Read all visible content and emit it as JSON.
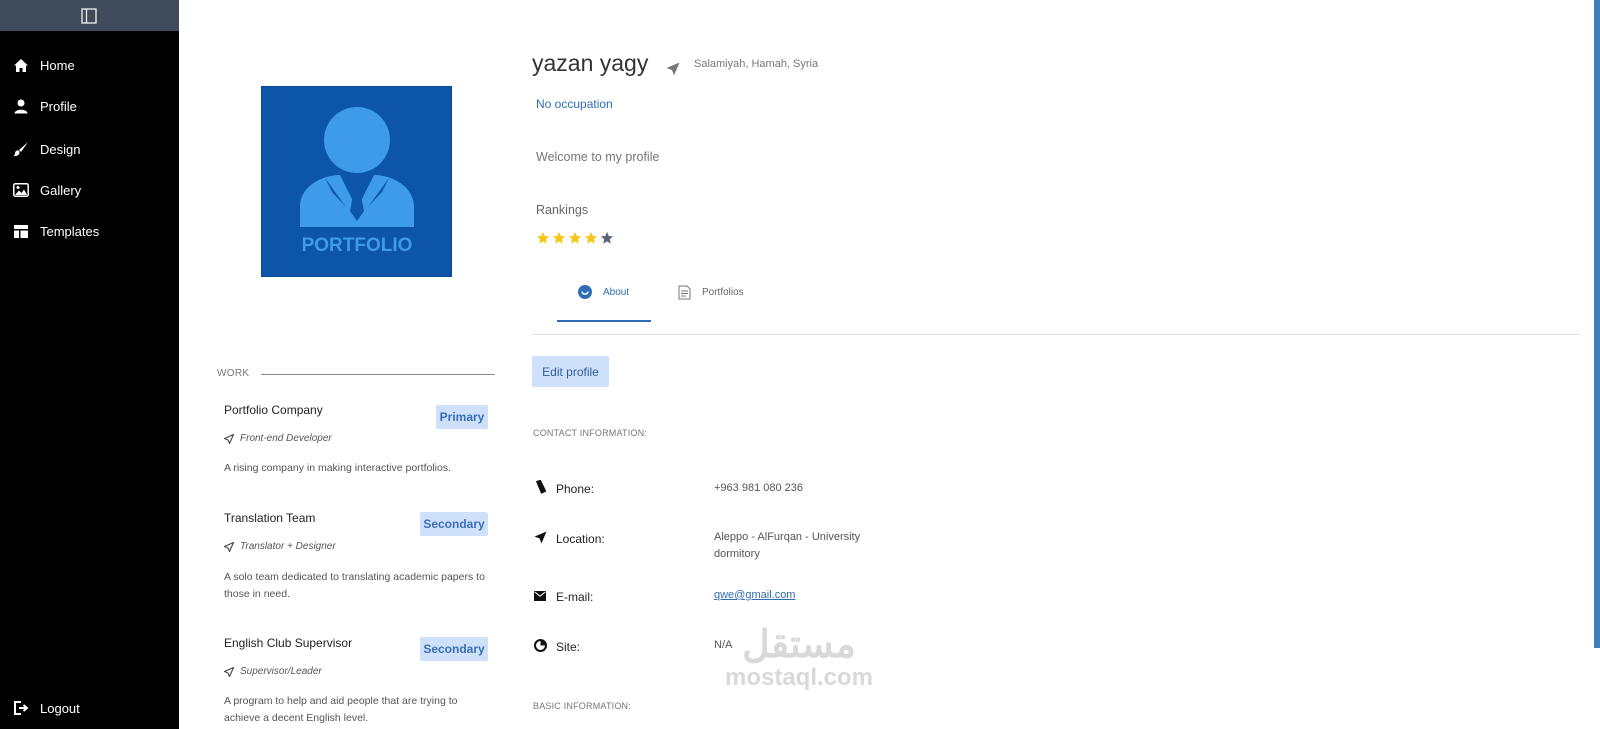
{
  "sidebar": {
    "toggle_icon": "sidebar-toggle-icon",
    "items": [
      {
        "label": "Home",
        "icon": "home-icon"
      },
      {
        "label": "Profile",
        "icon": "user-icon"
      },
      {
        "label": "Design",
        "icon": "brush-icon"
      },
      {
        "label": "Gallery",
        "icon": "image-icon"
      },
      {
        "label": "Templates",
        "icon": "layout-icon"
      }
    ],
    "logout": {
      "label": "Logout",
      "icon": "logout-icon"
    }
  },
  "avatar": {
    "caption": "PORTFOLIO"
  },
  "work": {
    "title": "WORK",
    "jobs": [
      {
        "company": "Portfolio Company",
        "badge": "Primary",
        "role": "Front-end Developer",
        "description": "A rising company in making interactive portfolios."
      },
      {
        "company": "Translation Team",
        "badge": "Secondary",
        "role": "Translator + Designer",
        "description": "A solo team dedicated to translating academic papers to those in need."
      },
      {
        "company": "English Club Supervisor",
        "badge": "Secondary",
        "role": "Supervisor/Leader",
        "description": "A program to help and aid people that are trying to achieve a decent English level."
      }
    ]
  },
  "profile": {
    "name": "yazan yagy",
    "location": "Salamiyah, Hamah, Syria",
    "occupation": "No occupation",
    "welcome": "Welcome to my profile",
    "rankings_label": "Rankings",
    "rating": 4,
    "rating_max": 5,
    "star_color": "#f5c518",
    "star_empty_color": "#5a6577"
  },
  "tabs": [
    {
      "label": "About",
      "icon": "smile-icon",
      "active": true
    },
    {
      "label": "Portfolios",
      "icon": "document-icon",
      "active": false
    }
  ],
  "edit_button": "Edit profile",
  "contact": {
    "title": "CONTACT INFORMATION:",
    "phone_label": "Phone:",
    "phone_value": "+963 981 080 236",
    "location_label": "Location:",
    "location_value": "Aleppo - AlFurqan - University dormitory",
    "email_label": "E-mail:",
    "email_value": "qwe@gmail.com",
    "site_label": "Site:",
    "site_value": "N/A"
  },
  "basic": {
    "title": "BASIC INFORMATION:"
  },
  "watermark": {
    "arabic": "مستقل",
    "latin": "mostaql.com"
  },
  "colors": {
    "accent": "#2f6db5",
    "badge_bg": "#cfe1fa",
    "sidebar_bg": "#000000",
    "avatar_bg": "#0d55a8"
  }
}
